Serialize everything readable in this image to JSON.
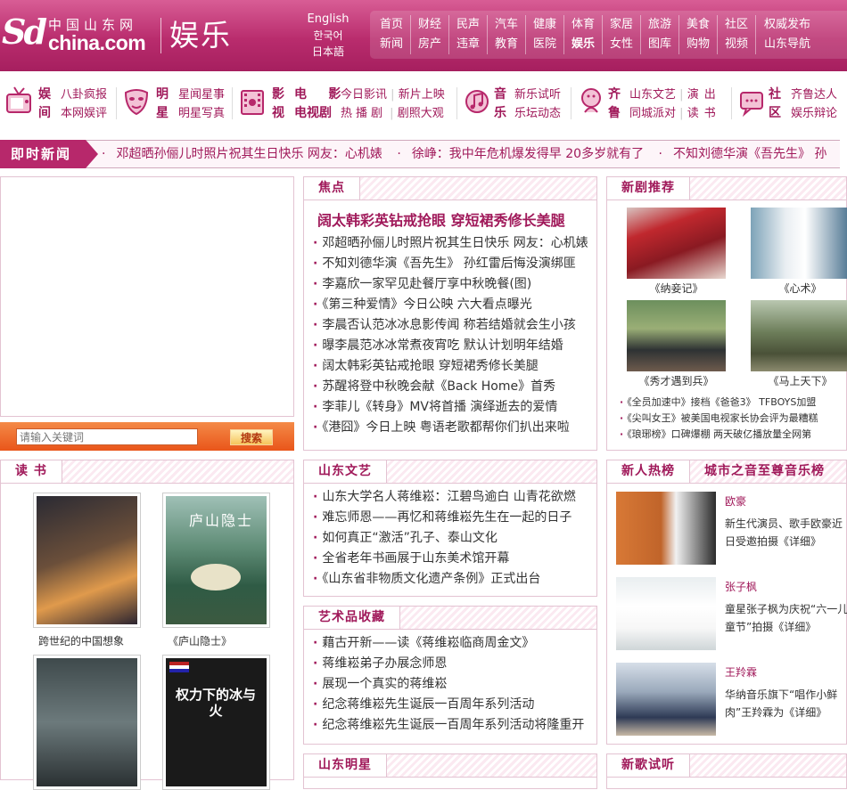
{
  "header": {
    "logo_sd": "Sd",
    "logo_cn": "中国山东网",
    "logo_com": "china.com",
    "channel": "娱乐",
    "languages": [
      "English",
      "한국어",
      "日本語"
    ],
    "nav_row1": [
      "首页",
      "财经",
      "民声",
      "汽车",
      "健康",
      "体育",
      "家居",
      "旅游",
      "美食",
      "社区",
      "权威发布"
    ],
    "nav_row2": [
      "新闻",
      "房产",
      "违章",
      "教育",
      "医院",
      "娱乐",
      "女性",
      "图库",
      "购物",
      "视频",
      "山东导航"
    ]
  },
  "categories": [
    {
      "icon": "tv-icon",
      "title": "娱间",
      "links": [
        [
          "八卦疯报"
        ],
        [
          "本网娱评"
        ]
      ]
    },
    {
      "icon": "mask-icon",
      "title": "明星",
      "links": [
        [
          "星闻星事"
        ],
        [
          "明星写真"
        ]
      ]
    },
    {
      "icon": "film-icon",
      "title2": [
        "影视",
        "电",
        "影",
        "电视剧"
      ],
      "links": [
        [
          "今日影讯",
          "新片上映"
        ],
        [
          "热播剧",
          "剧照大观"
        ]
      ]
    },
    {
      "icon": "music-icon",
      "title": "音乐",
      "links": [
        [
          "新乐试听"
        ],
        [
          "乐坛动态"
        ]
      ]
    },
    {
      "icon": "lu-icon",
      "title": "齐鲁",
      "links": [
        [
          "山东文艺",
          "演出"
        ],
        [
          "同城派对",
          "读书"
        ]
      ]
    },
    {
      "icon": "community-icon",
      "title": "社区",
      "links": [
        [
          "齐鲁达人"
        ],
        [
          "娱乐辩论"
        ]
      ]
    }
  ],
  "ticker": {
    "label": "即时新闻",
    "items": [
      "邓超晒孙俪儿时照片祝其生日快乐 网友：心机婊",
      "徐峥：我中年危机爆发得早 20多岁就有了",
      "不知刘德华演《吾先生》 孙"
    ]
  },
  "search": {
    "placeholder": "请输入关键词",
    "button": "搜索"
  },
  "focus": {
    "title": "焦点",
    "headline": "阔太韩彩英钻戒抢眼 穿短裙秀修长美腿",
    "items": [
      "邓超晒孙俪儿时照片祝其生日快乐 网友：心机婊",
      "不知刘德华演《吾先生》 孙红雷后悔没演绑匪",
      "李嘉欣一家罕见赴餐厅享中秋晚餐(图)",
      "《第三种爱情》今日公映 六大看点曝光",
      "李晨否认范冰冰息影传闻 称若结婚就会生小孩",
      "曝李晨范冰冰常煮夜宵吃 默认计划明年结婚",
      "阔太韩彩英钻戒抢眼 穿短裙秀修长美腿",
      "苏醒将登中秋晚会献《Back Home》首秀",
      "李菲儿《转身》MV将首播 演绎逝去的爱情",
      "《港囧》今日上映 粤语老歌都帮你们扒出来啦"
    ]
  },
  "dramas": {
    "title": "新剧推荐",
    "thumbs": [
      "《纳妾记》",
      "《心术》",
      "《秀才遇到兵》",
      "《马上天下》"
    ],
    "items": [
      "《全员加速中》接档《爸爸3》 TFBOYS加盟",
      "《尖叫女王》被美国电视家长协会评为最糟糕",
      "《琅琊榜》口碑爆棚 两天破亿播放量全网第"
    ]
  },
  "reading": {
    "title": "读 书",
    "books": [
      "跨世纪的中国想象",
      "《庐山隐士》",
      "",
      ""
    ],
    "cover2_title": "庐山隐士",
    "cover4_title": "权力下的冰与火"
  },
  "culture": {
    "title": "山东文艺",
    "items": [
      "山东大学名人蒋维崧：江碧鸟逾白 山青花欲燃",
      "难忘师恩——再忆和蒋维崧先生在一起的日子",
      "如何真正“激活”孔子、泰山文化",
      "全省老年书画展于山东美术馆开幕",
      "《山东省非物质文化遗产条例》正式出台"
    ]
  },
  "art": {
    "title": "艺术品收藏",
    "items": [
      "藉古开新——读《蒋维崧临商周金文》",
      "蒋维崧弟子办展念师恩",
      "展现一个真实的蒋维崧",
      "纪念蒋维崧先生诞辰一百周年系列活动",
      "纪念蒋维崧先生诞辰一百周年系列活动将隆重开"
    ]
  },
  "shandong_stars": {
    "title": "山东明星"
  },
  "newcomers": {
    "tab1": "新人热榜",
    "tab2": "城市之音至尊音乐榜",
    "stars": [
      {
        "name": "欧豪",
        "desc": "新生代演员、歌手欧豪近日受邀拍摄《详细》"
      },
      {
        "name": "张子枫",
        "desc": "童星张子枫为庆祝“六一儿童节”拍摄《详细》"
      },
      {
        "name": "王羚霖",
        "desc": "华纳音乐旗下“唱作小鲜肉”王羚霖为《详细》"
      }
    ]
  },
  "newsongs": {
    "title": "新歌试听"
  },
  "colors": {
    "brand": "#b7286b",
    "link": "#a0195a",
    "search_bg": "#e9551a"
  }
}
